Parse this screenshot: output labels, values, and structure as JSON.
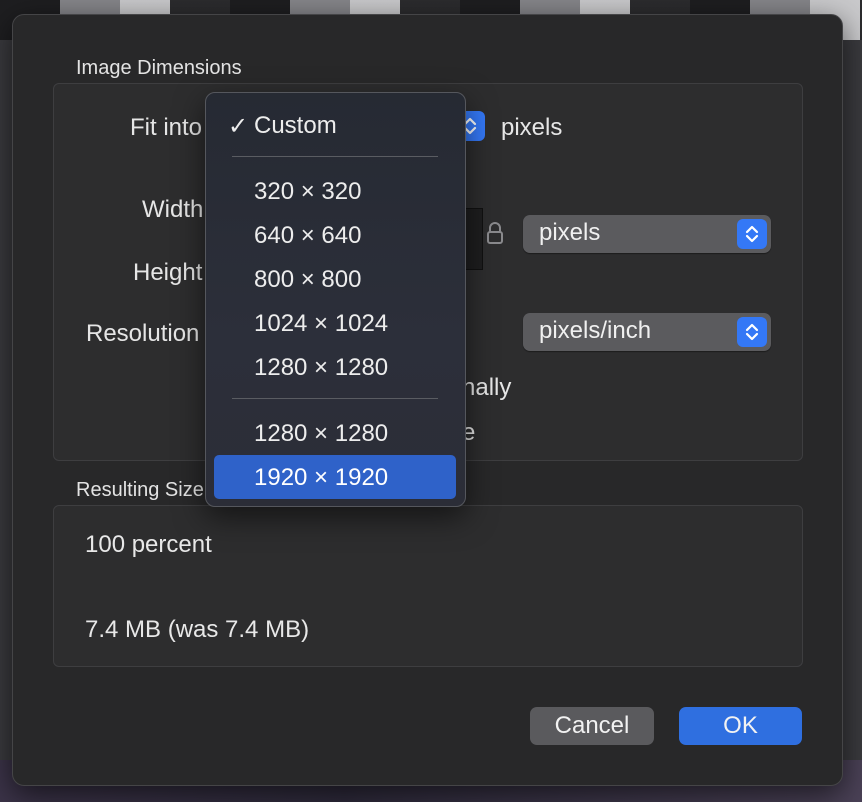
{
  "dialog": {
    "image_dimensions_title": "Image Dimensions",
    "fit_into_label": "Fit into",
    "fit_into_unit": "pixels",
    "width_label": "Width",
    "height_label": "Height",
    "resolution_label": "Resolution",
    "size_unit_popup": "pixels",
    "resolution_unit_popup": "pixels/inch",
    "scale_proportionally_partial": "nally",
    "resample_partial": "e",
    "resulting_size_title": "Resulting Size",
    "percent_text": "100 percent",
    "file_size_text": "7.4 MB (was 7.4 MB)",
    "cancel_label": "Cancel",
    "ok_label": "OK"
  },
  "fit_menu": {
    "check_glyph": "✓",
    "items": [
      {
        "label": "Custom",
        "checked": true
      },
      {
        "label": "320 × 320"
      },
      {
        "label": "640 × 640"
      },
      {
        "label": "800 × 800"
      },
      {
        "label": "1024 × 1024"
      },
      {
        "label": "1280 × 1280"
      },
      {
        "label": "1280 × 1280"
      },
      {
        "label": "1920 × 1920",
        "highlighted": true
      }
    ]
  },
  "icons": {
    "stepper": "chevron-up-down-icon",
    "lock": "lock-icon"
  },
  "colors": {
    "accent": "#3478f6",
    "highlight": "#2f62c9",
    "sheet_bg": "#282829"
  }
}
